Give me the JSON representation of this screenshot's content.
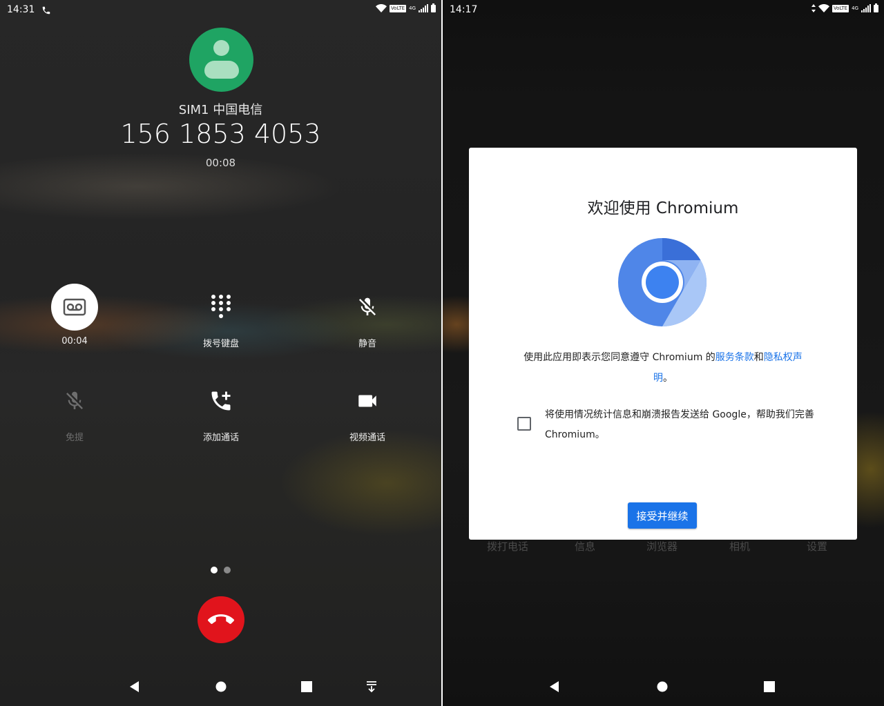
{
  "left": {
    "status_time": "14:31",
    "status_volte": "VoLTE",
    "status_net": "4G",
    "sim_label": "SIM1 中国电信",
    "phone_number": "156 1853 4053",
    "call_duration": "00:08",
    "buttons": [
      {
        "label": "00:04",
        "icon": "record-icon"
      },
      {
        "label": "拨号键盘",
        "icon": "dialpad-icon"
      },
      {
        "label": "静音",
        "icon": "mute-icon"
      },
      {
        "label": "免提",
        "icon": "speaker-icon"
      },
      {
        "label": "添加通话",
        "icon": "add-call-icon"
      },
      {
        "label": "视频通话",
        "icon": "video-call-icon"
      }
    ],
    "page_dots": {
      "count": 2,
      "active": 0
    }
  },
  "right": {
    "status_time": "14:17",
    "status_volte": "VoLTE",
    "status_net": "4G",
    "home_labels": [
      "拨打电话",
      "信息",
      "浏览器",
      "相机",
      "设置"
    ],
    "dialog": {
      "title": "欢迎使用 Chromium",
      "terms_prefix": "使用此应用即表示您同意遵守 Chromium 的",
      "terms_link1": "服务条款",
      "terms_and": "和",
      "terms_link2": "隐私权声明",
      "terms_suffix": "。",
      "checkbox_text": "将使用情况统计信息和崩溃报告发送给 Google，帮助我们完善 Chromium。",
      "checkbox_checked": false,
      "accept_label": "接受并继续"
    }
  },
  "colors": {
    "avatar_green": "#1fa463",
    "hangup_red": "#e1141c",
    "accent_blue": "#1a73e8"
  }
}
